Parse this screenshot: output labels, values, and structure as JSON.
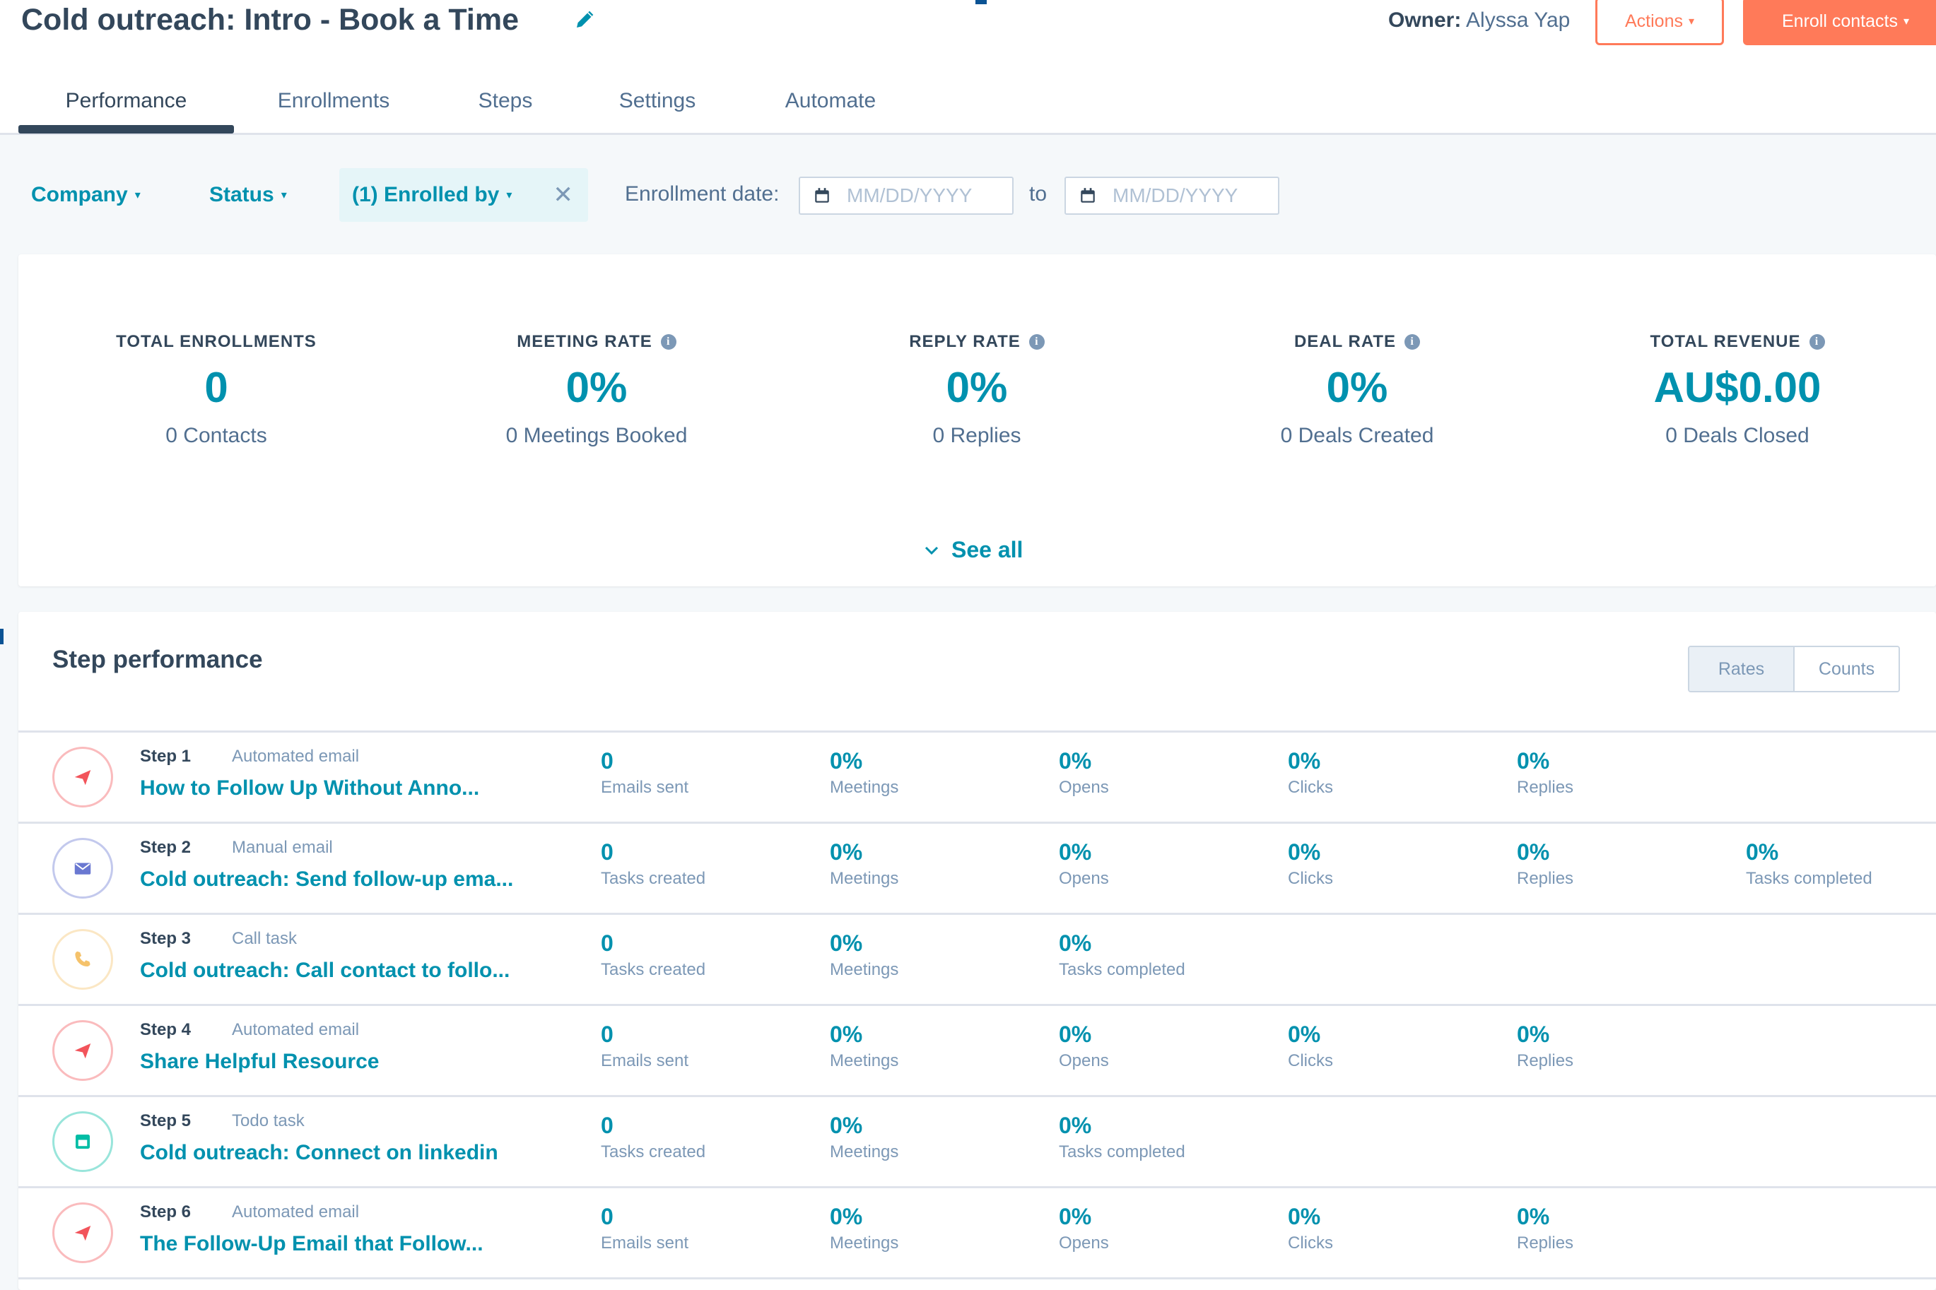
{
  "header": {
    "title": "Cold outreach: Intro - Book a Time",
    "owner_label": "Owner:",
    "owner_name": "Alyssa Yap",
    "actions_label": "Actions",
    "enroll_label": "Enroll contacts"
  },
  "tabs": [
    {
      "label": "Performance"
    },
    {
      "label": "Enrollments"
    },
    {
      "label": "Steps"
    },
    {
      "label": "Settings"
    },
    {
      "label": "Automate"
    }
  ],
  "filters": {
    "company": "Company",
    "status": "Status",
    "enrolled_by": "(1) Enrolled by",
    "enrollment_date_label": "Enrollment date:",
    "date_from_placeholder": "MM/DD/YYYY",
    "date_to_label": "to",
    "date_to_placeholder": "MM/DD/YYYY"
  },
  "summary": {
    "metrics": [
      {
        "label": "TOTAL ENROLLMENTS",
        "value": "0",
        "sub": "0 Contacts"
      },
      {
        "label": "MEETING RATE",
        "value": "0%",
        "sub": "0 Meetings Booked"
      },
      {
        "label": "REPLY RATE",
        "value": "0%",
        "sub": "0 Replies"
      },
      {
        "label": "DEAL RATE",
        "value": "0%",
        "sub": "0 Deals Created"
      },
      {
        "label": "TOTAL REVENUE",
        "value": "AU$0.00",
        "sub": "0 Deals Closed"
      }
    ],
    "see_all": "See all"
  },
  "step_performance": {
    "title": "Step performance",
    "toggle": {
      "rates": "Rates",
      "counts": "Counts"
    },
    "steps": [
      {
        "num": "Step 1",
        "type": "Automated email",
        "name": "How to Follow Up Without Anno...",
        "icon": "send-icon",
        "color": "#f2545b",
        "stats": [
          {
            "value": "0",
            "label": "Emails sent"
          },
          {
            "value": "0%",
            "label": "Meetings"
          },
          {
            "value": "0%",
            "label": "Opens"
          },
          {
            "value": "0%",
            "label": "Clicks"
          },
          {
            "value": "0%",
            "label": "Replies"
          }
        ]
      },
      {
        "num": "Step 2",
        "type": "Manual email",
        "name": "Cold outreach: Send follow-up ema...",
        "icon": "envelope-icon",
        "color": "#6a78d1",
        "stats": [
          {
            "value": "0",
            "label": "Tasks created"
          },
          {
            "value": "0%",
            "label": "Meetings"
          },
          {
            "value": "0%",
            "label": "Opens"
          },
          {
            "value": "0%",
            "label": "Clicks"
          },
          {
            "value": "0%",
            "label": "Replies"
          },
          {
            "value": "0%",
            "label": "Tasks completed"
          }
        ]
      },
      {
        "num": "Step 3",
        "type": "Call task",
        "name": "Cold outreach: Call contact to follo...",
        "icon": "phone-icon",
        "color": "#f5c26b",
        "stats": [
          {
            "value": "0",
            "label": "Tasks created"
          },
          {
            "value": "0%",
            "label": "Meetings"
          },
          {
            "value": "0%",
            "label": "Tasks completed"
          }
        ]
      },
      {
        "num": "Step 4",
        "type": "Automated email",
        "name": "Share Helpful Resource",
        "icon": "send-icon",
        "color": "#f2545b",
        "stats": [
          {
            "value": "0",
            "label": "Emails sent"
          },
          {
            "value": "0%",
            "label": "Meetings"
          },
          {
            "value": "0%",
            "label": "Opens"
          },
          {
            "value": "0%",
            "label": "Clicks"
          },
          {
            "value": "0%",
            "label": "Replies"
          }
        ]
      },
      {
        "num": "Step 5",
        "type": "Todo task",
        "name": "Cold outreach: Connect on linkedin",
        "icon": "task-icon",
        "color": "#00bda5",
        "stats": [
          {
            "value": "0",
            "label": "Tasks created"
          },
          {
            "value": "0%",
            "label": "Meetings"
          },
          {
            "value": "0%",
            "label": "Tasks completed"
          }
        ]
      },
      {
        "num": "Step 6",
        "type": "Automated email",
        "name": "The Follow-Up Email that Follow...",
        "icon": "send-icon",
        "color": "#f2545b",
        "stats": [
          {
            "value": "0",
            "label": "Emails sent"
          },
          {
            "value": "0%",
            "label": "Meetings"
          },
          {
            "value": "0%",
            "label": "Opens"
          },
          {
            "value": "0%",
            "label": "Clicks"
          },
          {
            "value": "0%",
            "label": "Replies"
          }
        ]
      }
    ]
  },
  "colors": {
    "accent": "#0091ae",
    "primary_action": "#ff7a59",
    "text": "#33475b",
    "muted": "#7c98b6"
  }
}
